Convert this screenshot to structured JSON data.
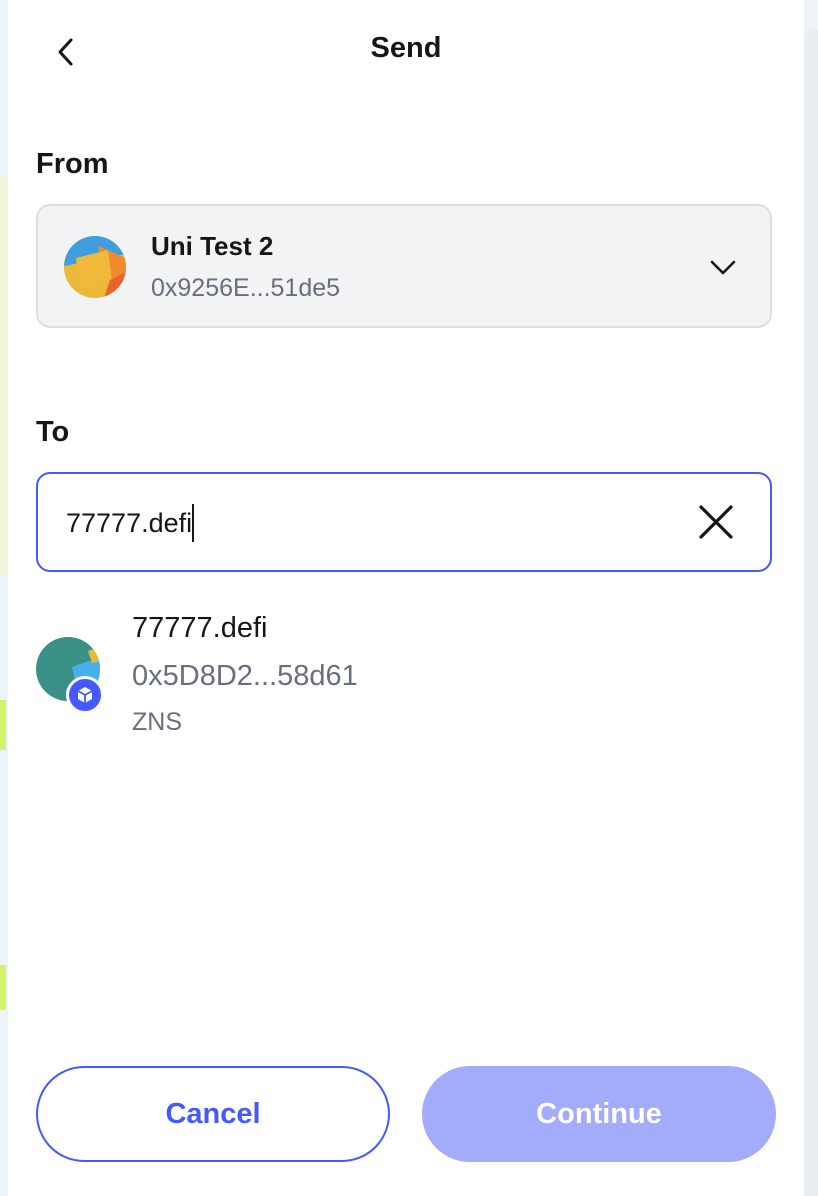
{
  "header": {
    "title": "Send"
  },
  "from": {
    "label": "From",
    "account_name": "Uni Test 2",
    "account_address": "0x9256E...51de5"
  },
  "to": {
    "label": "To",
    "input_value": "77777.defi"
  },
  "result": {
    "name": "77777.defi",
    "address": "0x5D8D2...58d61",
    "source": "ZNS"
  },
  "actions": {
    "cancel": "Cancel",
    "continue": "Continue"
  },
  "colors": {
    "accent": "#4459ff",
    "continue_disabled": "#a3acfb",
    "muted_text": "#686e7d"
  }
}
